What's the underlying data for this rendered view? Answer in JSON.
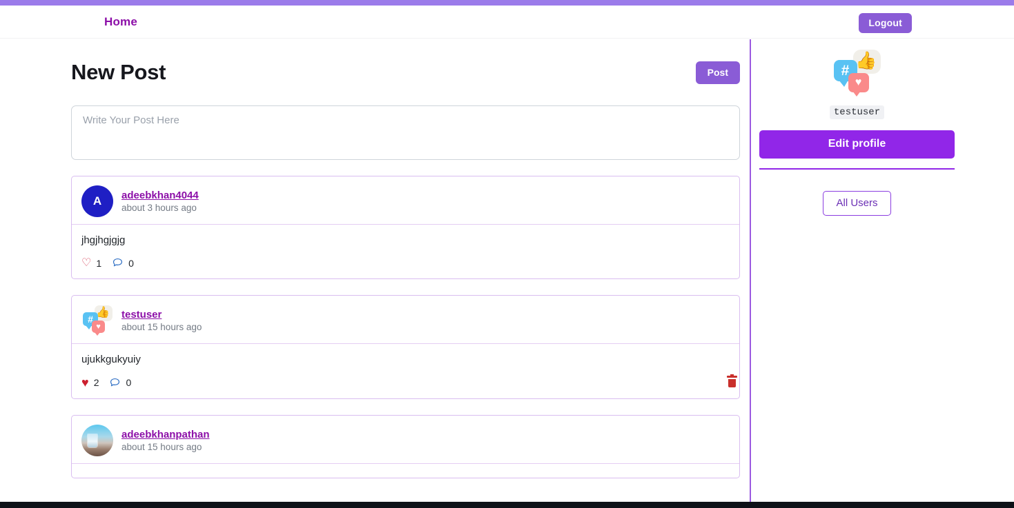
{
  "navbar": {
    "home_label": "Home",
    "logout_label": "Logout"
  },
  "new_post": {
    "title": "New Post",
    "post_button_label": "Post",
    "textarea_placeholder": "Write Your Post Here",
    "textarea_value": ""
  },
  "feed": {
    "posts": [
      {
        "username": "adeebkhan4044",
        "time": "about 3 hours ago",
        "body": "jhgjhgjgjg",
        "avatar_type": "initial",
        "avatar_initial": "A",
        "likes": "1",
        "liked": false,
        "comments": "0",
        "deletable": false
      },
      {
        "username": "testuser",
        "time": "about 15 hours ago",
        "body": "ujukkgukyuiy",
        "avatar_type": "bubbles",
        "avatar_initial": "",
        "likes": "2",
        "liked": true,
        "comments": "0",
        "deletable": true
      },
      {
        "username": "adeebkhanpathan",
        "time": "about 15 hours ago",
        "body": "",
        "avatar_type": "photo",
        "avatar_initial": "",
        "likes": "",
        "liked": false,
        "comments": "",
        "deletable": false
      }
    ]
  },
  "sidebar": {
    "username": "testuser",
    "edit_profile_label": "Edit profile",
    "all_users_label": "All Users",
    "avatar_icon": "social-bubbles-icon",
    "hash_glyph": "#",
    "thumb_glyph": "👍",
    "heart_glyph": "♥"
  },
  "icons": {
    "heart_outline": "♡",
    "heart_filled": "♥",
    "comment": "💬",
    "trash": "trash-icon"
  },
  "colors": {
    "accent_purple": "#8a5cd6",
    "brand_purple": "#9126e8",
    "link_purple": "#8c0fa8",
    "topbar": "#9b7bea",
    "like_red": "#cc1f2e",
    "delete_red": "#c9302c",
    "avatar_blue": "#1f1fc4"
  }
}
